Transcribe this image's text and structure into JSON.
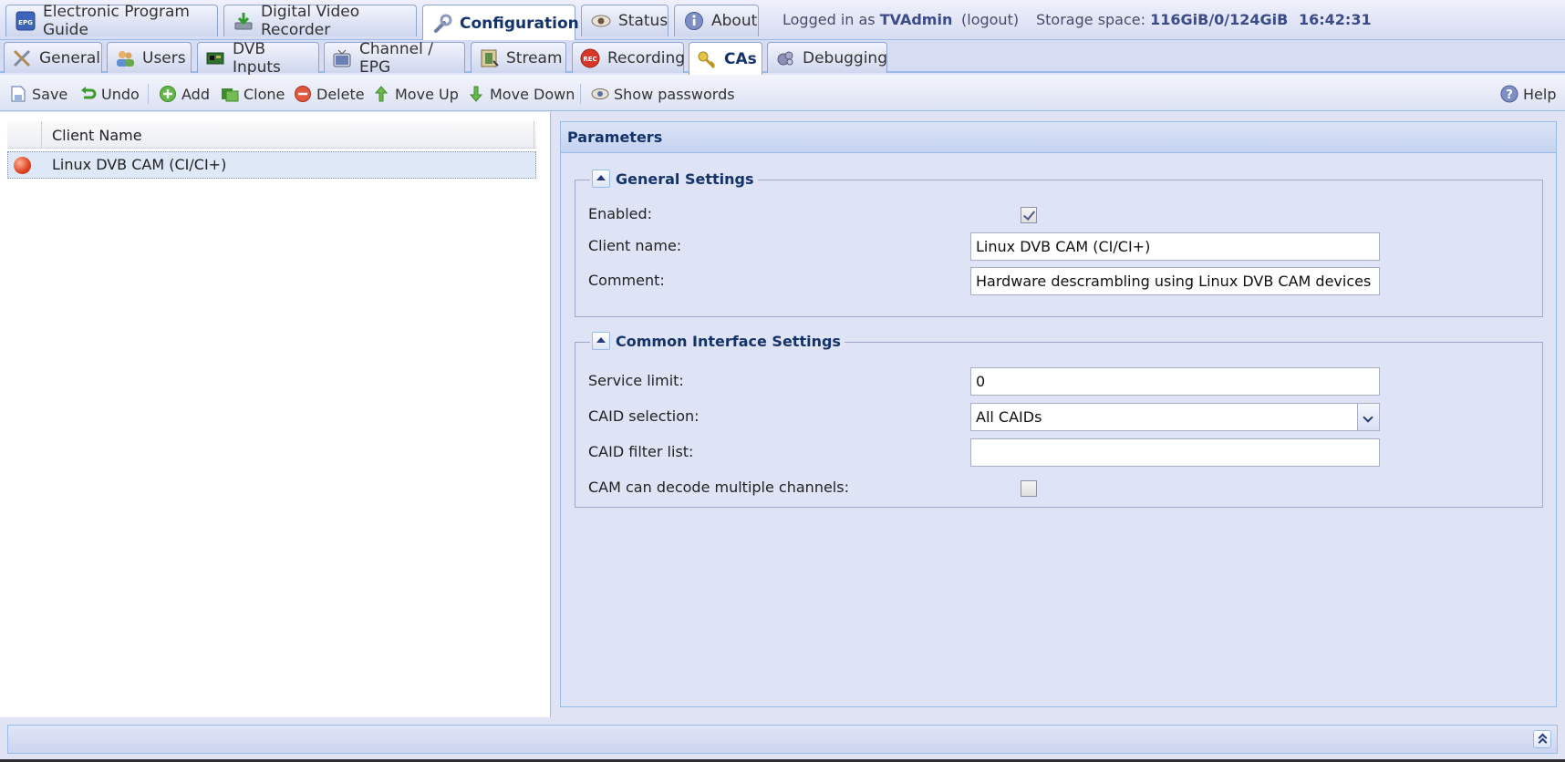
{
  "top_tabs": [
    {
      "label": "Electronic Program Guide",
      "icon": "epg-icon"
    },
    {
      "label": "Digital Video Recorder",
      "icon": "download-icon"
    },
    {
      "label": "Configuration",
      "icon": "wrench-icon",
      "active": true
    },
    {
      "label": "Status",
      "icon": "eye-icon"
    },
    {
      "label": "About",
      "icon": "info-icon"
    }
  ],
  "session": {
    "logged_in_prefix": "Logged in as",
    "user": "TVAdmin",
    "logout": "(logout)",
    "storage_label": "Storage space:",
    "storage_value": "116GiB/0/124GiB",
    "time": "16:42:31"
  },
  "sub_tabs": [
    {
      "label": "General",
      "icon": "tools-icon"
    },
    {
      "label": "Users",
      "icon": "users-icon"
    },
    {
      "label": "DVB Inputs",
      "icon": "tuner-card-icon"
    },
    {
      "label": "Channel / EPG",
      "icon": "tv-icon"
    },
    {
      "label": "Stream",
      "icon": "film-icon"
    },
    {
      "label": "Recording",
      "icon": "rec-icon"
    },
    {
      "label": "CAs",
      "icon": "key-icon",
      "active": true
    },
    {
      "label": "Debugging",
      "icon": "bug-icon"
    }
  ],
  "toolbar": {
    "save": "Save",
    "undo": "Undo",
    "add": "Add",
    "clone": "Clone",
    "delete": "Delete",
    "move_up": "Move Up",
    "move_down": "Move Down",
    "show_passwords": "Show passwords",
    "help": "Help"
  },
  "grid": {
    "column_header": "Client Name",
    "rows": [
      {
        "status_icon": "red-status-dot-icon",
        "name": "Linux DVB CAM (CI/CI+)",
        "selected": true
      }
    ]
  },
  "parameters": {
    "title": "Parameters",
    "general_settings": {
      "legend": "General Settings",
      "enabled_label": "Enabled:",
      "enabled": true,
      "client_name_label": "Client name:",
      "client_name_value": "Linux DVB CAM (CI/CI+)",
      "comment_label": "Comment:",
      "comment_value": "Hardware descrambling using Linux DVB CAM devices"
    },
    "common_interface": {
      "legend": "Common Interface Settings",
      "service_limit_label": "Service limit:",
      "service_limit_value": "0",
      "caid_selection_label": "CAID selection:",
      "caid_selection_value": "All CAIDs",
      "caid_filter_label": "CAID filter list:",
      "caid_filter_value": "",
      "multi_channel_label": "CAM can decode multiple channels:",
      "multi_channel": false
    }
  },
  "colors": {
    "accent": "#15336b",
    "panel_bg": "#dfe3f6",
    "border": "#99bbe8",
    "selected_row": "#dfe8f6",
    "status_dot": "#e0411e"
  }
}
